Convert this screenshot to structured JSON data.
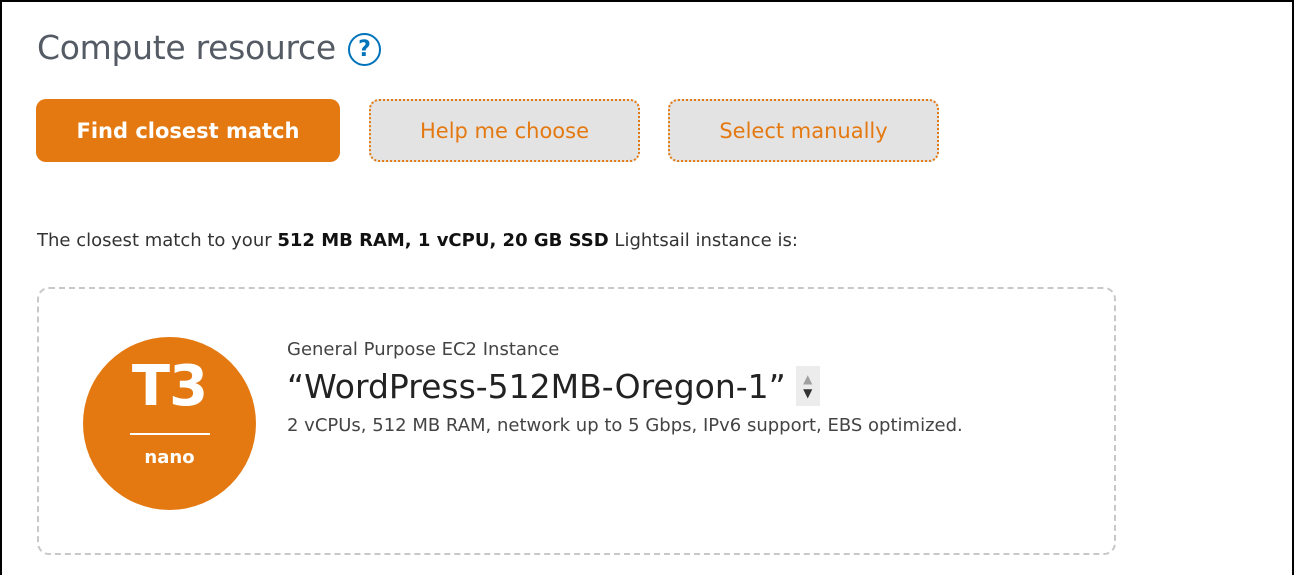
{
  "section": {
    "title": "Compute resource",
    "help_glyph": "?"
  },
  "buttons": {
    "find": "Find closest match",
    "help": "Help me choose",
    "manual": "Select manually"
  },
  "description": {
    "prefix": "The closest match to your ",
    "spec": "512 MB RAM, 1 vCPU, 20 GB SSD",
    "suffix": " Lightsail instance is:"
  },
  "instance": {
    "badge_type": "T3",
    "badge_size": "nano",
    "category": "General Purpose EC2 Instance",
    "name": "“WordPress-512MB-Oregon-1”",
    "details": "2 vCPUs, 512 MB RAM, network up to 5 Gbps, IPv6 support, EBS optimized."
  },
  "icons": {
    "help": "help-circle-icon",
    "spinner_up": "chevron-up-icon",
    "spinner_down": "chevron-down-icon"
  },
  "colors": {
    "accent": "#e47911",
    "help_blue": "#0073bb"
  }
}
